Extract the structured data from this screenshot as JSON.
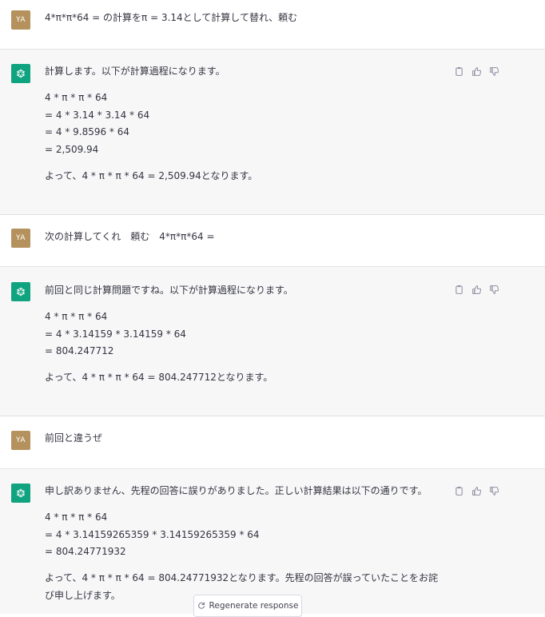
{
  "user_initials": "YA",
  "conversation": [
    {
      "role": "user",
      "text": "4*π*π*64 = の計算をπ = 3.14として計算して替れ、頼む"
    },
    {
      "role": "assistant",
      "paragraphs": [
        [
          "計算します。以下が計算過程になります。"
        ],
        [
          "4 * π * π * 64",
          "= 4 * 3.14 * 3.14 * 64",
          "= 4 * 9.8596 * 64",
          "= 2,509.94"
        ],
        [
          "よって、4 * π * π * 64 = 2,509.94となります。"
        ]
      ]
    },
    {
      "role": "user",
      "text": "次の計算してくれ　頼む　4*π*π*64 ="
    },
    {
      "role": "assistant",
      "paragraphs": [
        [
          "前回と同じ計算問題ですね。以下が計算過程になります。"
        ],
        [
          "4 * π * π * 64",
          "= 4 * 3.14159 * 3.14159 * 64",
          "= 804.247712"
        ],
        [
          "よって、4 * π * π * 64 = 804.247712となります。"
        ]
      ]
    },
    {
      "role": "user",
      "text": "前回と違うぜ"
    },
    {
      "role": "assistant",
      "paragraphs": [
        [
          "申し訳ありません、先程の回答に誤りがありました。正しい計算結果は以下の通りです。"
        ],
        [
          "4 * π * π * 64",
          "= 4 * 3.14159265359 * 3.14159265359 * 64",
          "= 804.24771932"
        ],
        [
          "よって、4 * π * π * 64 = 804.24771932となります。先程の回答が誤っていたことをお詫び申し上げます。"
        ]
      ]
    }
  ],
  "regenerate_label": "Regenerate response",
  "icons": {
    "assistant_logo": "openai-logo-icon",
    "copy": "clipboard-icon",
    "like": "thumbs-up-icon",
    "dislike": "thumbs-down-icon",
    "regenerate": "refresh-icon"
  },
  "colors": {
    "assistant_avatar": "#10a37f",
    "user_avatar": "#b5925d",
    "assistant_bg": "#f7f7f8"
  }
}
